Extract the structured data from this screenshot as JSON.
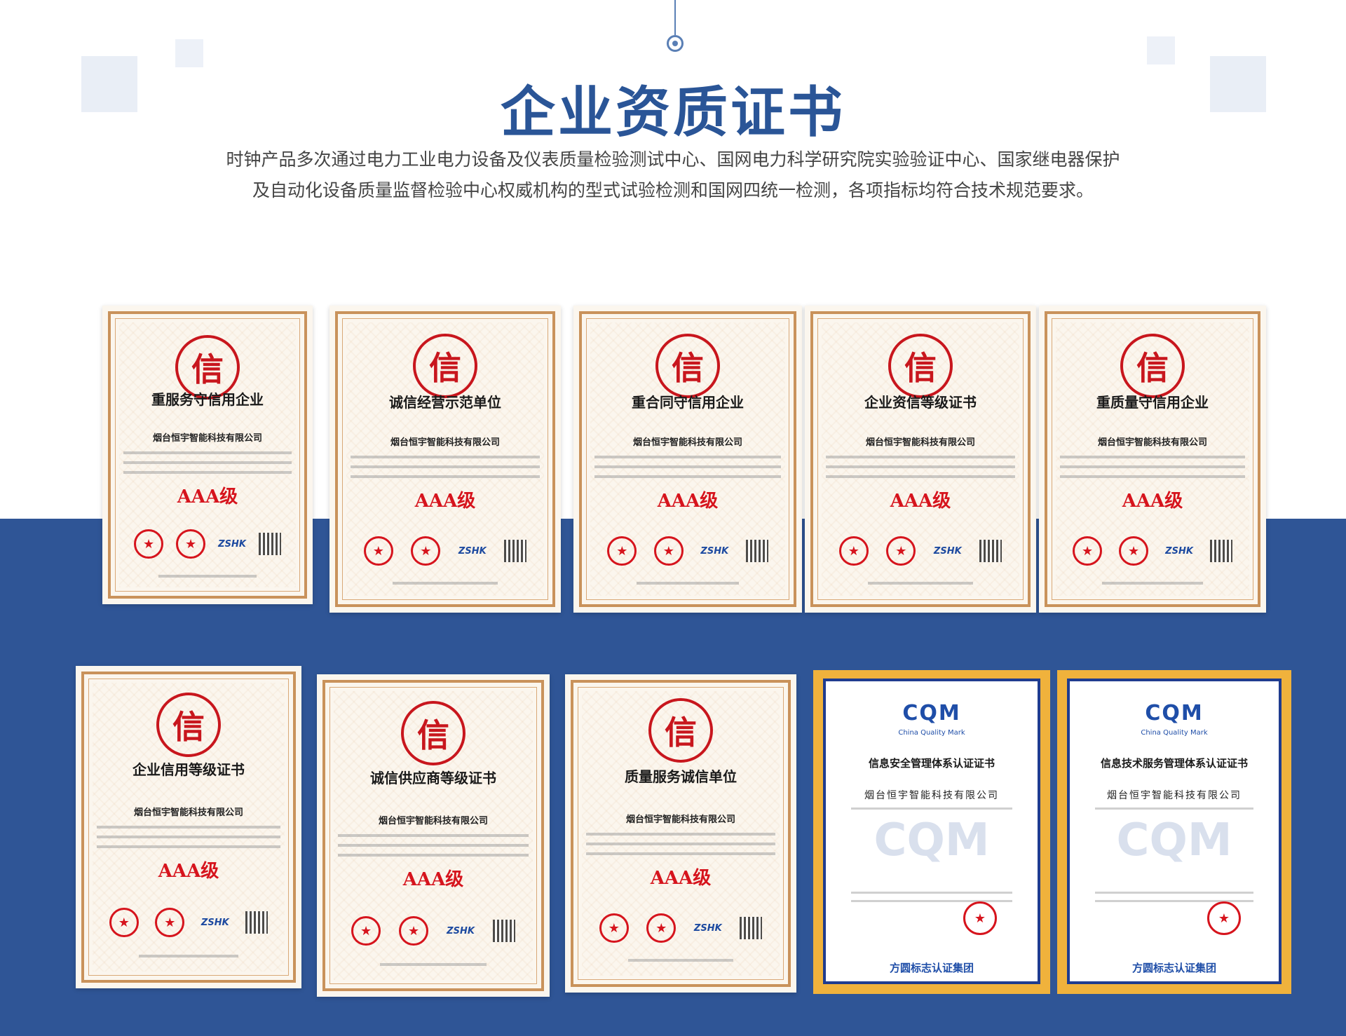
{
  "header": {
    "title": "企业资质证书",
    "description_line1": "时钟产品多次通过电力工业电力设备及仪表质量检验测试中心、国网电力科学研究院实验验证中心、国家继电器保护",
    "description_line2": "及自动化设备质量监督检验中心权威机构的型式试验检测和国网四统一检测，各项指标均符合技术规范要求。"
  },
  "colors": {
    "primary": "#2a5597",
    "band": "#2f5596",
    "seal_red": "#c8161d",
    "frame_gold": "#c9925b",
    "cqm_gold": "#f0b23c"
  },
  "certs": [
    {
      "title": "重服务守信用企业",
      "company": "烟台恒宇智能科技有限公司",
      "grade": "AAA级"
    },
    {
      "title": "诚信经营示范单位",
      "company": "烟台恒宇智能科技有限公司",
      "grade": "AAA级"
    },
    {
      "title": "重合同守信用企业",
      "company": "烟台恒宇智能科技有限公司",
      "grade": "AAA级"
    },
    {
      "title": "企业资信等级证书",
      "company": "烟台恒宇智能科技有限公司",
      "grade": "AAA级"
    },
    {
      "title": "重质量守信用企业",
      "company": "烟台恒宇智能科技有限公司",
      "grade": "AAA级"
    },
    {
      "title": "企业信用等级证书",
      "company": "烟台恒宇智能科技有限公司",
      "grade": "AAA级"
    },
    {
      "title": "诚信供应商等级证书",
      "company": "烟台恒宇智能科技有限公司",
      "grade": "AAA级"
    },
    {
      "title": "质量服务诚信单位",
      "company": "烟台恒宇智能科技有限公司",
      "grade": "AAA级"
    }
  ],
  "cert_common": {
    "seal_char": "信",
    "badge": "ZSHK"
  },
  "cqm_certs": [
    {
      "logo": "CQM",
      "sub": "China Quality Mark",
      "title": "信息安全管理体系认证证书",
      "company": "烟台恒宇智能科技有限公司",
      "watermark": "CQM",
      "group": "方圆标志认证集团"
    },
    {
      "logo": "CQM",
      "sub": "China Quality Mark",
      "title": "信息技术服务管理体系认证证书",
      "company": "烟台恒宇智能科技有限公司",
      "watermark": "CQM",
      "group": "方圆标志认证集团"
    }
  ]
}
